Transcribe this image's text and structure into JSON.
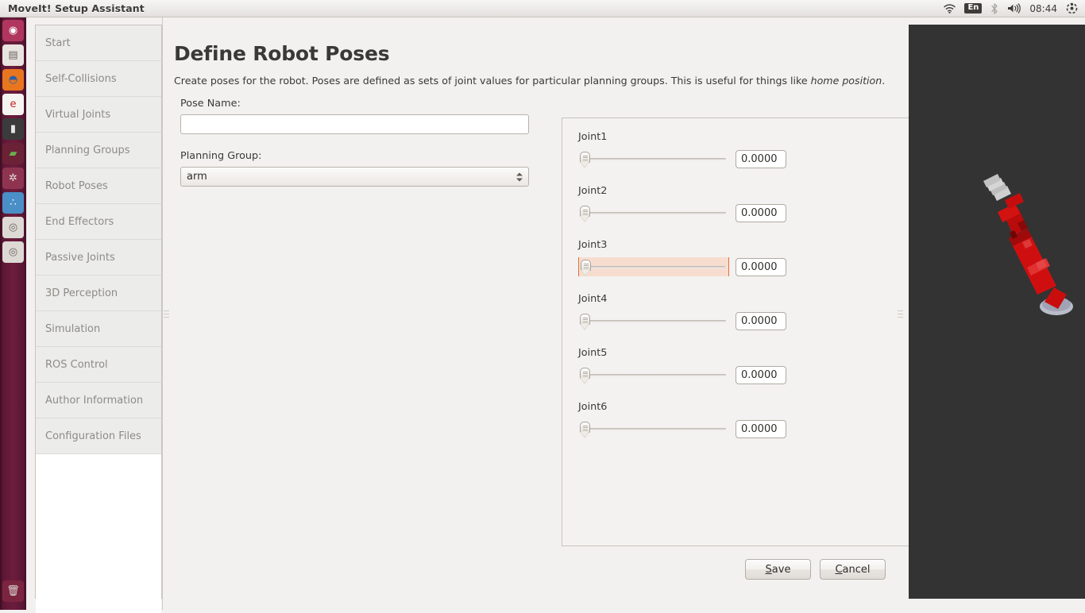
{
  "window": {
    "title": "MoveIt! Setup Assistant"
  },
  "tray": {
    "wifi_icon": "wifi-icon",
    "language": "En",
    "bluetooth_icon": "bluetooth-icon",
    "volume_icon": "volume-icon",
    "clock": "08:44",
    "system_icon": "system-gear-icon"
  },
  "launcher": {
    "items": [
      {
        "name": "ubuntu-dash-icon",
        "glyph": "◉",
        "bg": "#b0365f",
        "fg": "#ffffff",
        "running": false,
        "focused": false
      },
      {
        "name": "files-icon",
        "glyph": "▤",
        "bg": "#e8e4df",
        "fg": "#6a6560",
        "running": false,
        "focused": false
      },
      {
        "name": "firefox-icon",
        "glyph": "◓",
        "bg": "#e8761f",
        "fg": "#2a5fa8",
        "running": true,
        "focused": false
      },
      {
        "name": "evince-icon",
        "glyph": "e",
        "bg": "#f6f4f1",
        "fg": "#c32027",
        "running": false,
        "focused": false
      },
      {
        "name": "terminal-icon",
        "glyph": "▮",
        "bg": "#3b3b3b",
        "fg": "#e6e6e6",
        "running": true,
        "focused": false
      },
      {
        "name": "software-center-icon",
        "glyph": "▰",
        "bg": "#6b2236",
        "fg": "#6ab04c",
        "running": false,
        "focused": false
      },
      {
        "name": "system-settings-icon",
        "glyph": "✲",
        "bg": "#8f3450",
        "fg": "#e4e0dc",
        "running": false,
        "focused": false
      },
      {
        "name": "moveit-setup-assistant-icon",
        "glyph": "∴",
        "bg": "#4a8fc7",
        "fg": "#ffffff",
        "running": true,
        "focused": true
      },
      {
        "name": "disk-volume-icon",
        "glyph": "◎",
        "bg": "#ddd9d4",
        "fg": "#6a6560",
        "running": false,
        "focused": false
      },
      {
        "name": "disk-volume-icon-2",
        "glyph": "◎",
        "bg": "#ddd9d4",
        "fg": "#6a6560",
        "running": false,
        "focused": false
      }
    ],
    "trash": {
      "name": "trash-icon",
      "glyph": "🗑",
      "bg": "#7b2440",
      "fg": "#ded9d4"
    }
  },
  "sidebar": {
    "items": [
      {
        "label": "Start"
      },
      {
        "label": "Self-Collisions"
      },
      {
        "label": "Virtual Joints"
      },
      {
        "label": "Planning Groups"
      },
      {
        "label": "Robot Poses"
      },
      {
        "label": "End Effectors"
      },
      {
        "label": "Passive Joints"
      },
      {
        "label": "3D Perception"
      },
      {
        "label": "Simulation"
      },
      {
        "label": "ROS Control"
      },
      {
        "label": "Author Information"
      },
      {
        "label": "Configuration Files"
      }
    ]
  },
  "main": {
    "title": "Define Robot Poses",
    "description_part1": "Create poses for the robot. Poses are defined as sets of joint values for particular planning groups. This is useful for things like ",
    "description_italic": "home position",
    "description_part2": ".",
    "pose_name_label": "Pose Name:",
    "pose_name_value": "",
    "pose_name_placeholder": "",
    "planning_group_label": "Planning Group:",
    "planning_group_value": "arm",
    "planning_group_options": [
      "arm"
    ],
    "joints": [
      {
        "label": "Joint1",
        "value": "0.0000",
        "focused": false
      },
      {
        "label": "Joint2",
        "value": "0.0000",
        "focused": false
      },
      {
        "label": "Joint3",
        "value": "0.0000",
        "focused": true
      },
      {
        "label": "Joint4",
        "value": "0.0000",
        "focused": false
      },
      {
        "label": "Joint5",
        "value": "0.0000",
        "focused": false
      },
      {
        "label": "Joint6",
        "value": "0.0000",
        "focused": false
      }
    ],
    "save_label": "Save",
    "save_mnemonic": "S",
    "cancel_label": "Cancel",
    "cancel_mnemonic": "C"
  },
  "view3d": {
    "background_color": "#333333",
    "robot_color": "#cc0000",
    "description": "red robot arm"
  }
}
